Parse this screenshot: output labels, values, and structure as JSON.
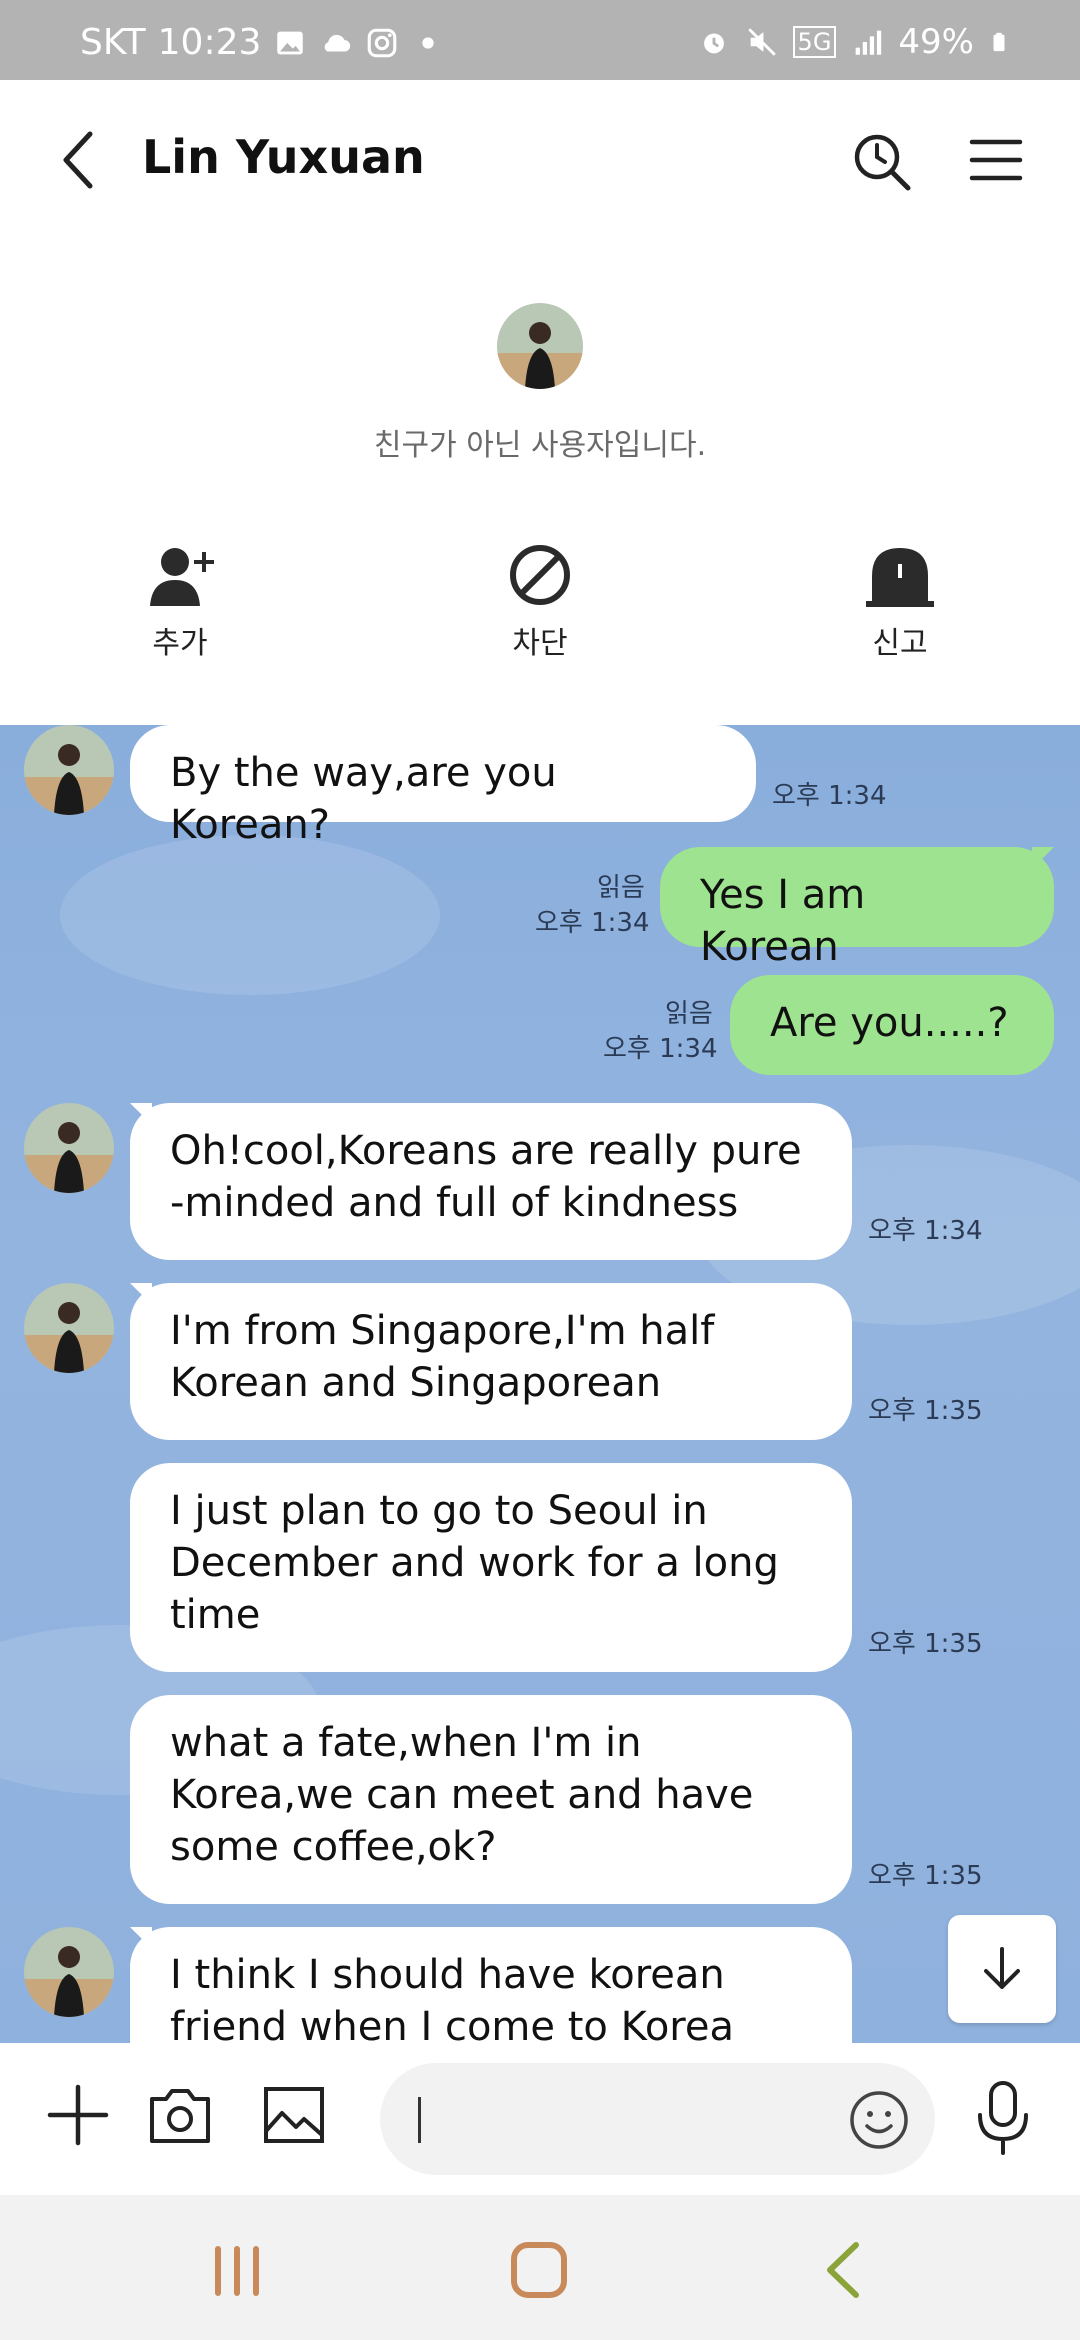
{
  "status_bar": {
    "carrier": "SKT",
    "time": "10:23",
    "network": "5G",
    "battery": "49%"
  },
  "header": {
    "title": "Lin Yuxuan"
  },
  "profile": {
    "notice": "친구가 아닌 사용자입니다.",
    "actions": [
      {
        "label": "추가",
        "icon": "add-friend-icon"
      },
      {
        "label": "차단",
        "icon": "block-icon"
      },
      {
        "label": "신고",
        "icon": "report-icon"
      }
    ]
  },
  "messages": [
    {
      "sender": "them",
      "text": "By the way,are you Korean?",
      "time": "오후 1:34"
    },
    {
      "sender": "me",
      "text": "Yes I am Korean",
      "read": "읽음",
      "time": "오후 1:34"
    },
    {
      "sender": "me",
      "text": "Are you.....?",
      "read": "읽음",
      "time": "오후 1:34"
    },
    {
      "sender": "them",
      "text": "Oh!cool,Koreans are really pure -minded  and full of kindness",
      "time": "오후 1:34"
    },
    {
      "sender": "them",
      "text": "I'm from Singapore,I'm half Korean and Singaporean",
      "time": "오후 1:35"
    },
    {
      "sender": "them",
      "text": "I just plan to go to Seoul in December and work for a long time",
      "time": "오후 1:35"
    },
    {
      "sender": "them",
      "text": "what a fate,when I'm in Korea,we can meet and have some coffee,ok?",
      "time": "오후 1:35"
    },
    {
      "sender": "them",
      "text": "I think I should have korean friend when I come to Korea",
      "time": ""
    }
  ],
  "colors": {
    "chat_background": "#8fb1dd",
    "my_bubble": "#9ee38f",
    "their_bubble": "#ffffff"
  }
}
